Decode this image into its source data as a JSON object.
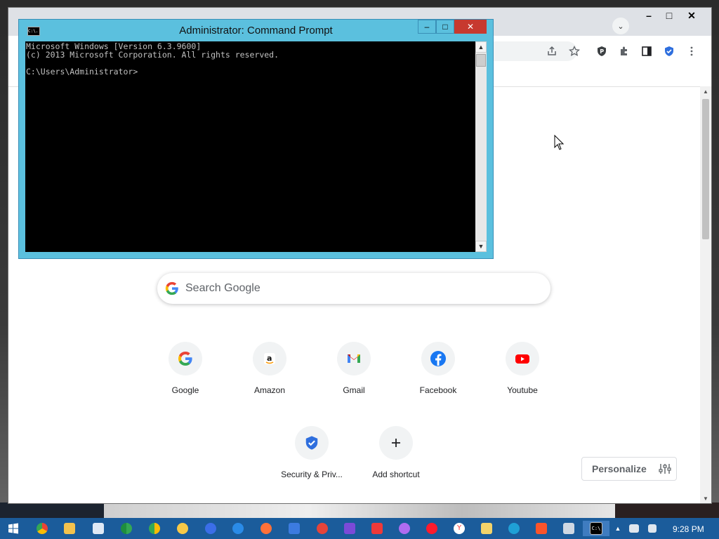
{
  "cmd": {
    "title": "Administrator: Command Prompt",
    "icon_label": "C:\\.",
    "line1": "Microsoft Windows [Version 6.3.9600]",
    "line2": "(c) 2013 Microsoft Corporation. All rights reserved.",
    "line3": "",
    "prompt": "C:\\Users\\Administrator>",
    "minimize": "–",
    "maximize": "□",
    "close": "✕"
  },
  "chrome": {
    "minimize": "–",
    "maximize": "□",
    "close": "✕",
    "tab_dropdown": "⌄"
  },
  "newtab": {
    "search_placeholder": "Search Google",
    "shortcuts": [
      {
        "label": "Google",
        "icon": "google-icon"
      },
      {
        "label": "Amazon",
        "icon": "amazon-icon"
      },
      {
        "label": "Gmail",
        "icon": "gmail-icon"
      },
      {
        "label": "Facebook",
        "icon": "facebook-icon"
      },
      {
        "label": "Youtube",
        "icon": "youtube-icon"
      },
      {
        "label": "Security & Priv...",
        "icon": "shield-icon"
      },
      {
        "label": "Add shortcut",
        "icon": "plus-icon"
      }
    ],
    "personalize": "Personalize"
  },
  "taskbar": {
    "time": "9:28 PM",
    "apps": [
      "start",
      "chrome",
      "explorer",
      "notepad",
      "chrome-green",
      "chrome-yellow",
      "sticky",
      "firefox-dev",
      "firefox-blue",
      "firefox",
      "brave",
      "chromium-red",
      "brave-nightly",
      "vivaldi",
      "opera-gx",
      "opera",
      "yandex",
      "files",
      "edge",
      "brave-orange",
      "server-manager",
      "cmd"
    ]
  },
  "colors": {
    "cmd_frame": "#5bc0de",
    "taskbar": "#1b5c9b",
    "chrome_frame": "#dee1e6"
  }
}
